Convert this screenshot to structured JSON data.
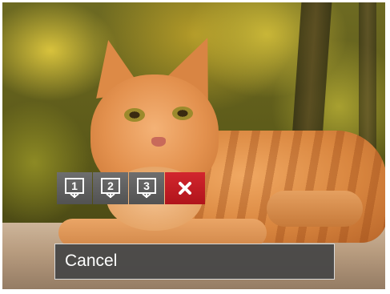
{
  "toolbar": {
    "items": [
      {
        "icon": "print-layout-1-icon",
        "number": "1"
      },
      {
        "icon": "print-layout-2-icon",
        "number": "2"
      },
      {
        "icon": "print-layout-3-icon",
        "number": "3"
      },
      {
        "icon": "close-icon"
      }
    ],
    "selected_index": 3
  },
  "hint": {
    "label": "Cancel"
  },
  "colors": {
    "selected": "#c81c24",
    "button": "#5e5e5e",
    "hint_bg": "#464646",
    "hint_border": "#d9d9d9"
  }
}
